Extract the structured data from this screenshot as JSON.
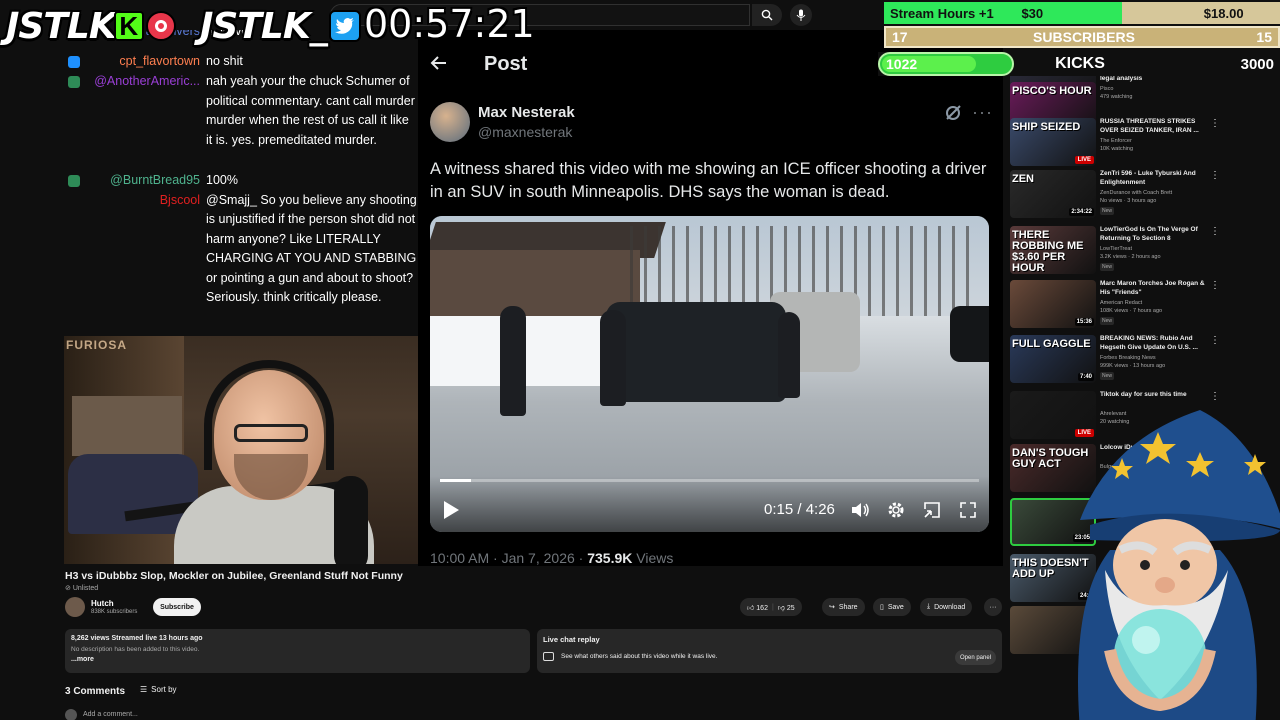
{
  "overlay": {
    "brand_kick": "JSTLK",
    "brand_kick_badge": "K",
    "brand_x": "JSTLK_",
    "timer": "00:57:21",
    "goals": {
      "hours_label": "Stream Hours +1",
      "hours_current": "$18.00",
      "hours_target": "$30",
      "hours_progress": 0.6,
      "subs_current": "17",
      "subs_label": "SUBSCRIBERS",
      "subs_target": "15",
      "kicks_current": "1022",
      "kicks_label": "KICKS",
      "kicks_target": "3000",
      "kicks_progress": 0.34
    }
  },
  "chat": {
    "partial_top": "rahedivers",
    "partial_top_msg": "hiolieve",
    "messages": [
      {
        "user": "cpt_flavortown",
        "color": "#ff7f50",
        "badge": "#1e90ff",
        "text": "no shit",
        "lines": 1
      },
      {
        "user": "@AnotherAmeric...",
        "color": "#9a3fd6",
        "badge": "#2e8b57",
        "text": "nah yeah your the chuck Schumer of political commentary. cant call murder murder when the rest of us call it like it is. yes. premeditated murder.",
        "lines": 5
      },
      {
        "user": "@BurntBread95",
        "color": "#4fb38e",
        "badge": "#2e8b57",
        "text": "100%",
        "lines": 1
      },
      {
        "user": "Bjscool",
        "color": "#e02020",
        "badge": "",
        "text": "@Smajj_ So you believe any shooting is unjustified if the person shot did not harm anyone? Like LITERALLY CHARGING AT YOU AND STABBING or pointing a gun and about to shoot? Seriously. think critically please.",
        "lines": 6
      }
    ]
  },
  "cam": {
    "overlay_text": "FURIOSA"
  },
  "post": {
    "header": "Post",
    "author_name": "Max Nesterak",
    "author_handle": "@maxnesterak",
    "text": "A witness shared this video with me showing an ICE officer shooting a driver in an SUV in south Minneapolis. DHS says the woman is dead.",
    "video_time": "0:15 / 4:26",
    "video_progress": 0.057,
    "meta_time": "10:00 AM · Jan 7, 2026 · ",
    "meta_views": "735.9K",
    "meta_views_label": " Views"
  },
  "youtube": {
    "title": "H3 vs iDubbbz Slop, Mockler on Jubilee, Greenland Stuff Not Funny",
    "unlisted": "Unlisted",
    "channel": "Hutch",
    "subscribers": "838K subscribers",
    "subscribe_label": "Subscribe",
    "likes": "162",
    "dislikes": "25",
    "share": "Share",
    "save": "Save",
    "download": "Download",
    "desc_views": "8,262 views  Streamed live 13 hours ago",
    "desc_text": "No description has been added to this video.",
    "desc_more": "...more",
    "chat_replay_title": "Live chat replay",
    "chat_replay_text": "See what others said about this video while it was live.",
    "chat_replay_open": "Open panel",
    "comments_count": "3 Comments",
    "sort_by": "Sort by",
    "add_comment": "Add a comment..."
  },
  "recommendations": [
    {
      "thumb_text": "",
      "title": "Late night ICE MURDER calling; legal analysis",
      "channel": "Pisco",
      "meta": "479 watching",
      "badge": "",
      "duration": "",
      "new": false
    },
    {
      "thumb_text": "PISCO'S HOUR",
      "title": "",
      "channel": "",
      "meta": "",
      "badge": "LIVE",
      "duration": "",
      "new": false
    },
    {
      "thumb_text": "SHIP SEIZED",
      "title": "RUSSIA THREATENS STRIKES OVER SEIZED TANKER, IRAN ...",
      "channel": "The Enforcer",
      "meta": "10K watching",
      "badge": "LIVE",
      "duration": "",
      "new": false
    },
    {
      "thumb_text": "ZEN",
      "title": "ZenTri 596 - Luke Tyburski And Enlightenment",
      "channel": "ZenDurance with Coach Brett",
      "meta": "No views · 3 hours ago",
      "badge": "",
      "duration": "2:34:22",
      "new": true
    },
    {
      "thumb_text": "THERE ROBBING ME $3.60 PER HOUR",
      "title": "LowTierGod Is On The Verge Of Returning To Section 8",
      "channel": "LowTierTreat",
      "meta": "3.2K views · 2 hours ago",
      "badge": "",
      "duration": "",
      "new": true
    },
    {
      "thumb_text": "",
      "title": "Marc Maron Torches Joe Rogan & His \"Friends\"",
      "channel": "American Redact",
      "meta": "108K views · 7 hours ago",
      "badge": "",
      "duration": "15:36",
      "new": true
    },
    {
      "thumb_text": "FULL GAGGLE",
      "title": "BREAKING NEWS: Rubio And Hegseth Give Update On U.S. ...",
      "channel": "Forbes Breaking News",
      "meta": "999K views · 13 hours ago",
      "badge": "",
      "duration": "7:40",
      "new": true
    },
    {
      "thumb_text": "",
      "title": "Tiktok day for sure this time",
      "channel": "Ahrelevant",
      "meta": "20 watching",
      "badge": "LIVE",
      "duration": "",
      "new": false
    },
    {
      "thumb_text": "DAN'S TOUGH GUY ACT",
      "title": "Lolcow iDubb Debate Ag...",
      "channel": "Bulgarian",
      "meta": "",
      "badge": "",
      "duration": "",
      "new": false
    },
    {
      "thumb_text": "",
      "title": "",
      "channel": "",
      "meta": "",
      "badge": "",
      "duration": "23:05",
      "new": false
    },
    {
      "thumb_text": "THIS DOESN'T ADD UP",
      "title": "",
      "channel": "",
      "meta": "",
      "badge": "",
      "duration": "24:5",
      "new": false
    },
    {
      "thumb_text": "",
      "title": "",
      "channel": "",
      "meta": "",
      "badge": "",
      "duration": "",
      "new": false
    }
  ],
  "colors": {
    "youtube_bg": "#0f0f0f",
    "x_bg": "#000000",
    "hours_fill": "#2ee85a",
    "kicks_fill": "#5cf04c",
    "live_red": "#cc0000"
  }
}
